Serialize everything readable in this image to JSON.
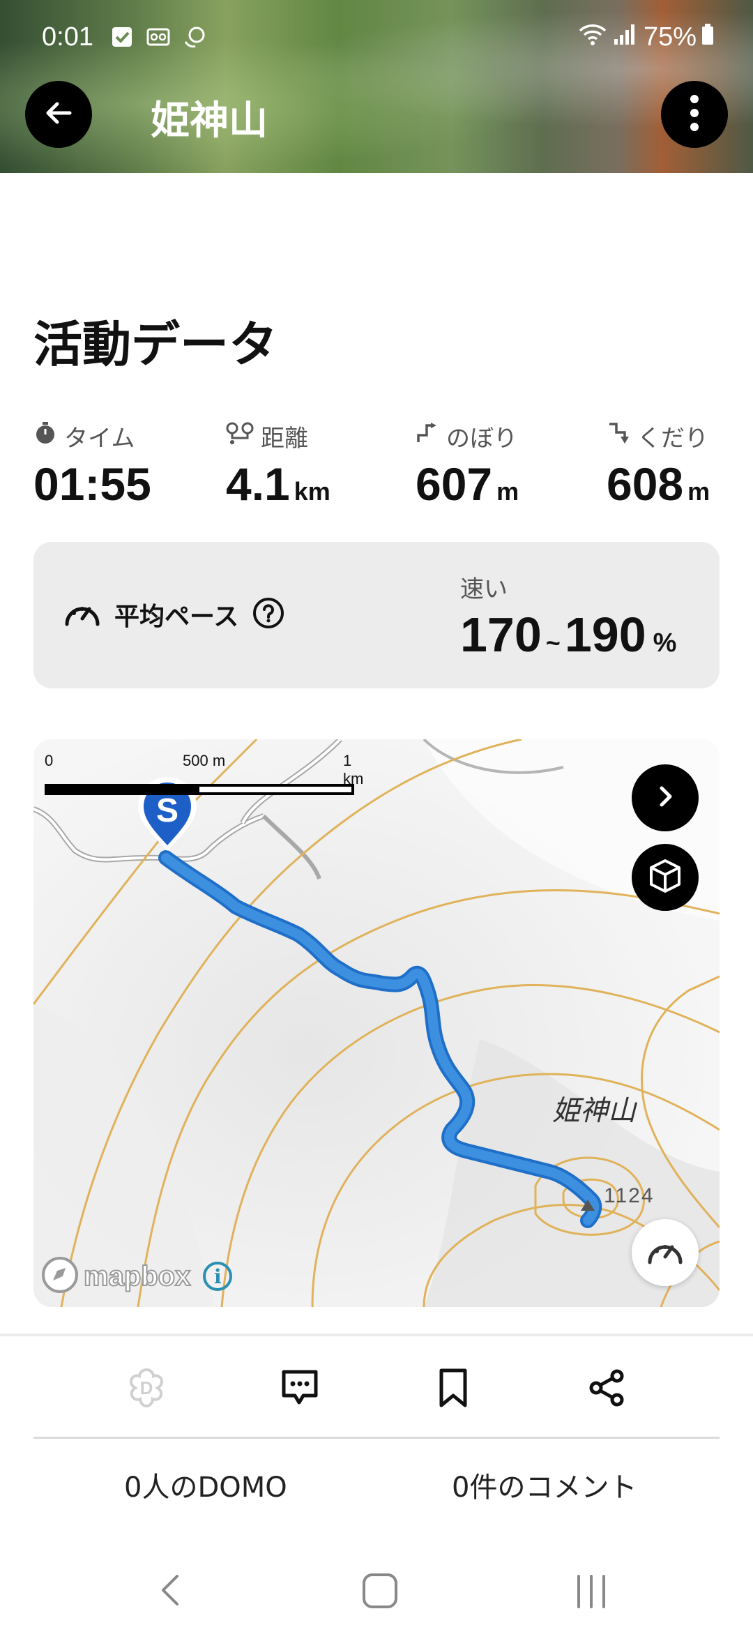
{
  "status_bar": {
    "time": "0:01",
    "battery": "75%"
  },
  "header": {
    "title": "姫神山",
    "back_icon": "arrow-left-icon",
    "more_icon": "more-vertical-icon"
  },
  "activity": {
    "section_title": "活動データ",
    "stats": [
      {
        "label": "タイム",
        "value": "01:55",
        "unit": ""
      },
      {
        "label": "距離",
        "value": "4.1",
        "unit": "km"
      },
      {
        "label": "のぼり",
        "value": "607",
        "unit": "m"
      },
      {
        "label": "くだり",
        "value": "608",
        "unit": "m"
      }
    ],
    "pace": {
      "label": "平均ペース",
      "speed_label": "速い",
      "min": "170",
      "tilde": "~",
      "max": "190",
      "unit": "%"
    }
  },
  "map": {
    "scale_labels": [
      "0",
      "500 m",
      "1 km"
    ],
    "start_marker": "S",
    "peak_name": "姫神山",
    "peak_elevation": "1124",
    "attribution": "mapbox",
    "info": "i",
    "route_color": "#3d8fe0",
    "contour_color": "#e0b25a"
  },
  "actions": {
    "domo_count": "0人のDOMO",
    "comment_count": "0件のコメント"
  }
}
